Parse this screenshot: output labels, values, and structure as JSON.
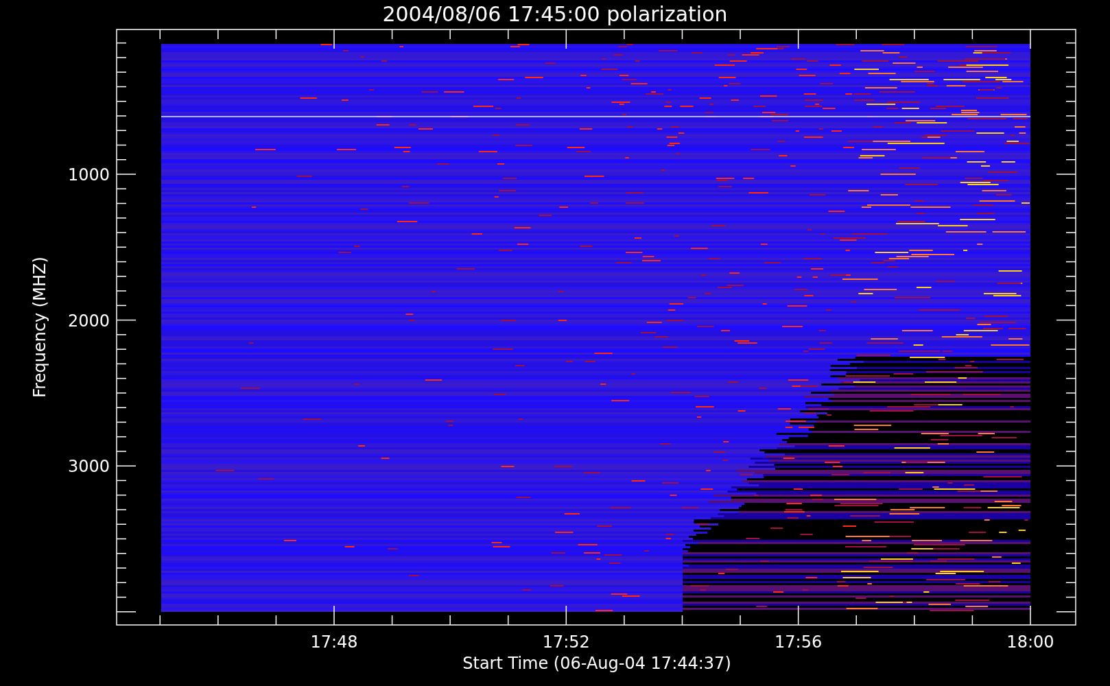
{
  "title": "2004/08/06 17:45:00 polarization",
  "y_axis": {
    "label": "Frequency (MHZ)",
    "tick_labels": [
      "1000",
      "2000",
      "3000"
    ]
  },
  "x_axis": {
    "label": "Start Time (06-Aug-04 17:44:37)",
    "tick_labels": [
      "17:48",
      "17:52",
      "17:56",
      "18:00"
    ]
  }
}
